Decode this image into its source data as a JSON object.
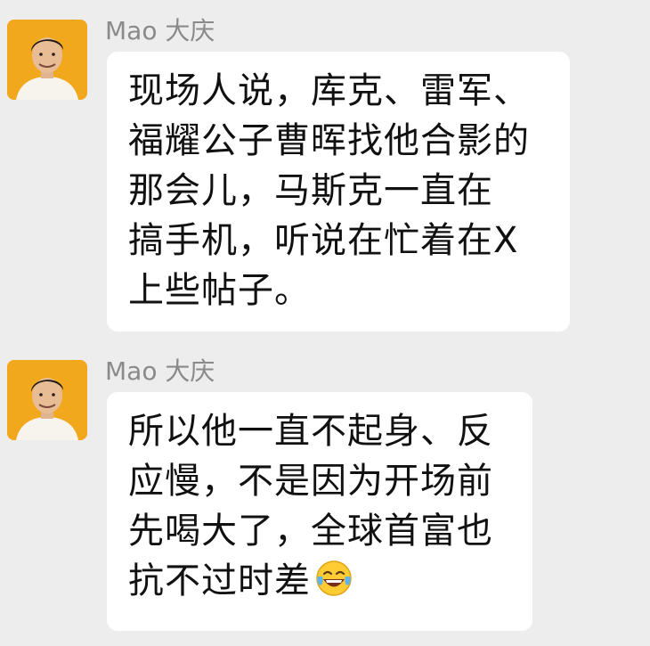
{
  "messages": [
    {
      "sender": "Mao 大庆",
      "lines": [
        "现场人说，库克、雷军、",
        "福耀公子曹晖找他合影的",
        "那会儿，马斯克一直在",
        "搞手机，听说在忙着在X",
        "上些帖子。"
      ]
    },
    {
      "sender": "Mao 大庆",
      "lines": [
        "所以他一直不起身、反",
        "应慢，不是因为开场前",
        "先喝大了，全球首富也",
        "抗不过时差"
      ],
      "trailing_icon": "tears-of-joy-emoji"
    }
  ],
  "colors": {
    "background": "#ededed",
    "bubble": "#ffffff",
    "avatar_bg": "#f2a81d",
    "sender_text": "#8a8a8a"
  }
}
